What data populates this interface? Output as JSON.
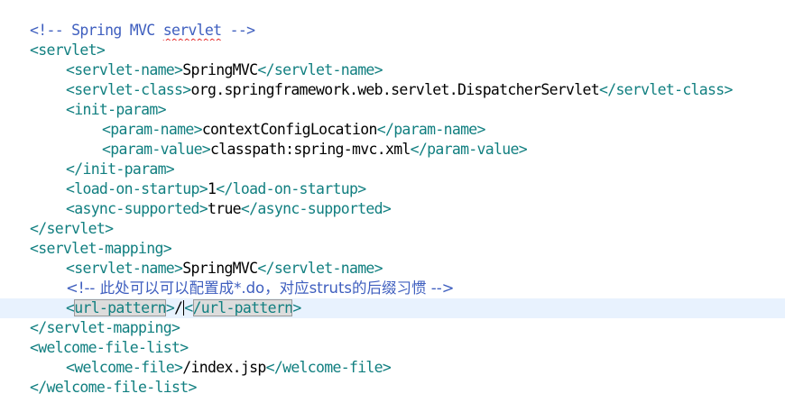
{
  "editor": {
    "lines": [
      {
        "parts": [
          "<!-- Spring MVC ",
          "servlet",
          " -->"
        ]
      },
      {
        "open": "<servlet>"
      },
      {
        "open": "<servlet-name>",
        "text": "SpringMVC",
        "close": "</servlet-name>"
      },
      {
        "open": "<servlet-class>",
        "text": "org.springframework.web.servlet.DispatcherServlet",
        "close": "</servlet-class>"
      },
      {
        "open": "<init-param>"
      },
      {
        "open": "<param-name>",
        "text": "contextConfigLocation",
        "close": "</param-name>"
      },
      {
        "open": "<param-value>",
        "text": "classpath:spring-mvc.xml",
        "close": "</param-value>"
      },
      {
        "close": "</init-param>"
      },
      {
        "open": "<load-on-startup>",
        "text": "1",
        "close": "</load-on-startup>"
      },
      {
        "open": "<async-supported>",
        "text": "true",
        "close": "</async-supported>"
      },
      {
        "close": "</servlet>"
      },
      {
        "open": "<servlet-mapping>"
      },
      {
        "open": "<servlet-name>",
        "text": "SpringMVC",
        "close": "</servlet-name>"
      },
      {
        "comment": "<!-- 此处可以可以配置成*.do，对应struts的后缀习惯 -->"
      },
      {
        "lt": "<",
        "tagname": "url-pattern",
        "gt": ">",
        "text": "/",
        "close_lt": "<",
        "close_tagname": "/url-pattern",
        "close_gt": ">"
      },
      {
        "close": "</servlet-mapping>"
      },
      {
        "open": "<welcome-file-list>"
      },
      {
        "open": "<welcome-file>",
        "text": "/index.jsp",
        "close": "</welcome-file>"
      },
      {
        "close": "</welcome-file-list>"
      }
    ]
  },
  "colors": {
    "tag": "#117f80",
    "comment": "#3f5fbf",
    "text": "#000000",
    "current_line": "#e8f2fe",
    "spell_error": "#e52020"
  }
}
